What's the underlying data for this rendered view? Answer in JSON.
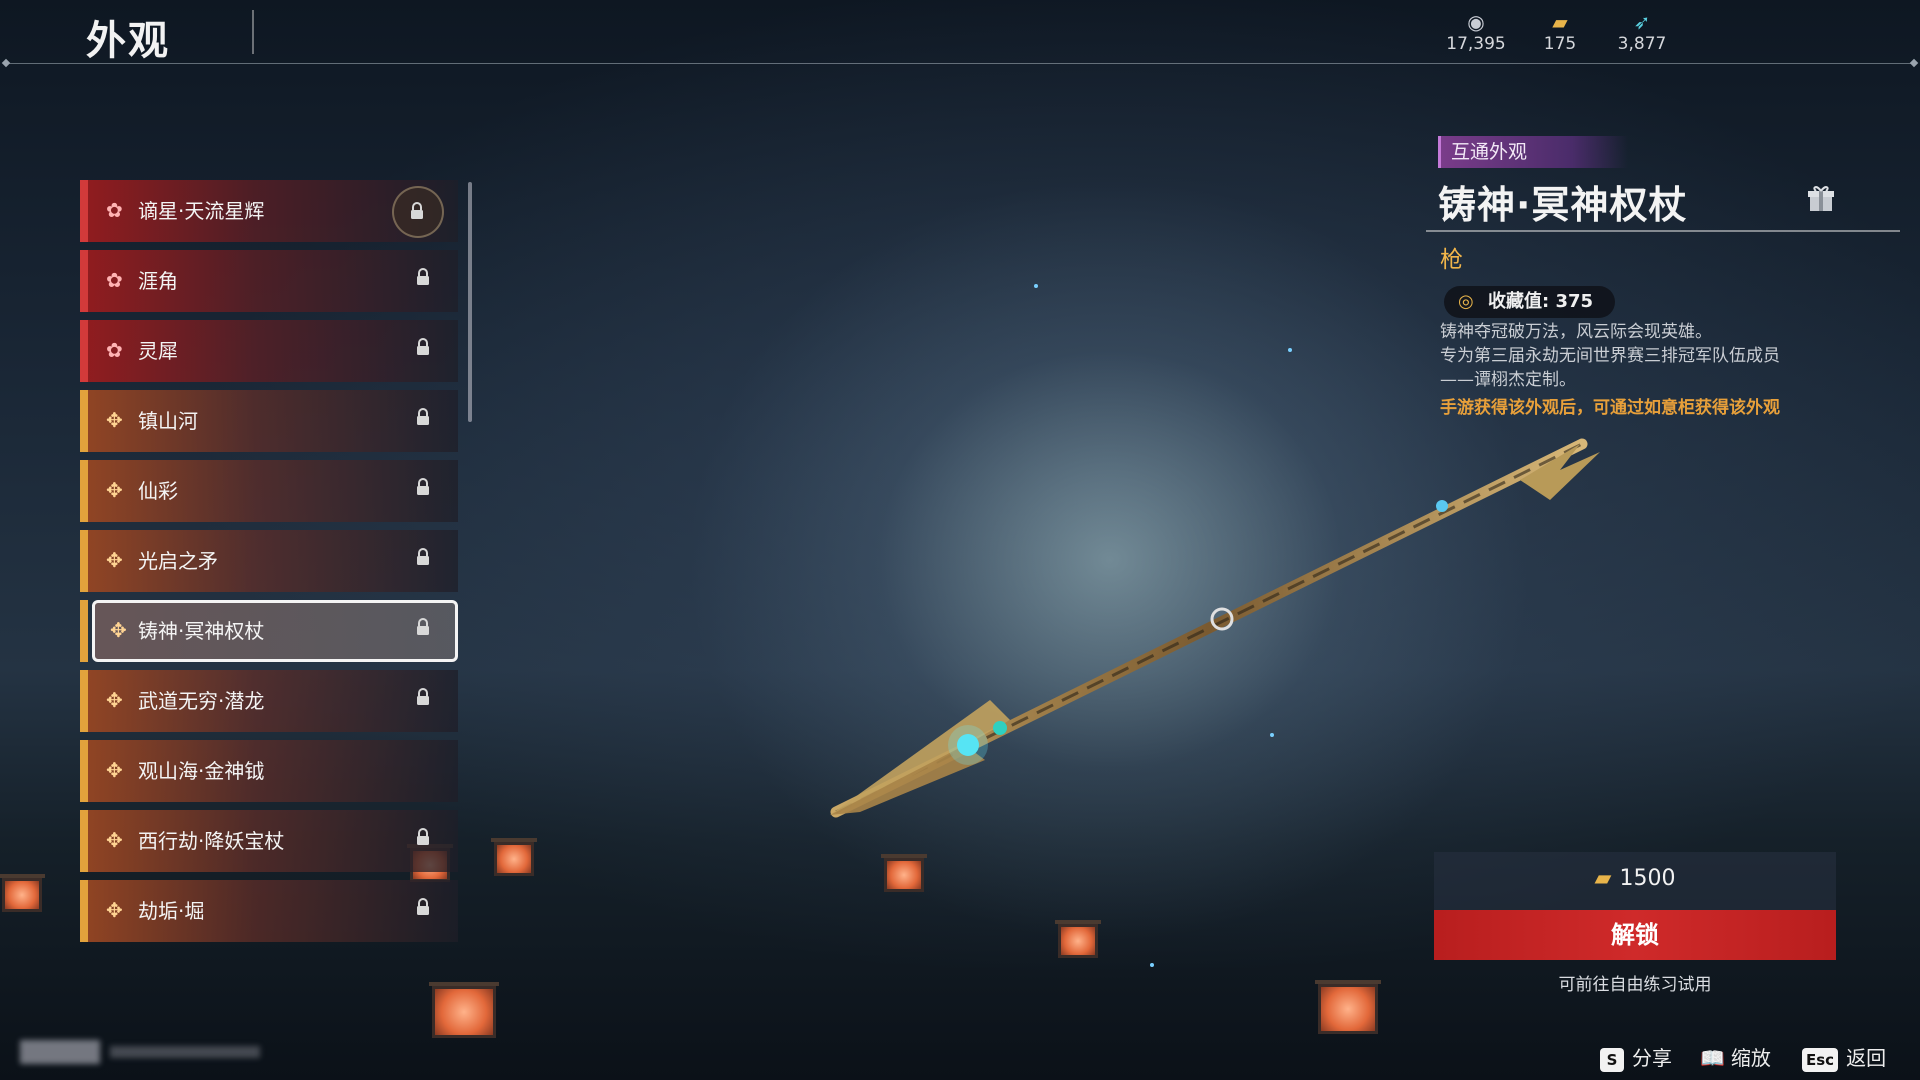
{
  "header": {
    "title": "外观",
    "currencies": [
      {
        "icon": "coin-icon",
        "value": "17,395"
      },
      {
        "icon": "gold-ingot-icon",
        "value": "175"
      },
      {
        "icon": "feather-icon",
        "value": "3,877"
      }
    ]
  },
  "list": {
    "items": [
      {
        "label": "谪星·天流星辉",
        "rarity": "red",
        "icon": "star-icon",
        "locked": true,
        "badge": true
      },
      {
        "label": "涯角",
        "rarity": "red",
        "icon": "star-icon",
        "locked": true
      },
      {
        "label": "灵犀",
        "rarity": "red",
        "icon": "star-icon",
        "locked": true
      },
      {
        "label": "镇山河",
        "rarity": "gold",
        "icon": "cross-icon",
        "locked": true
      },
      {
        "label": "仙彩",
        "rarity": "gold",
        "icon": "cross-icon",
        "locked": true
      },
      {
        "label": "光启之矛",
        "rarity": "gold",
        "icon": "cross-icon",
        "locked": true
      },
      {
        "label": "铸神·冥神权杖",
        "rarity": "gold",
        "icon": "cross-icon",
        "locked": true,
        "selected": true
      },
      {
        "label": "武道无穷·潜龙",
        "rarity": "gold",
        "icon": "cross-icon",
        "locked": true
      },
      {
        "label": "观山海·金神钺",
        "rarity": "gold",
        "icon": "cross-icon",
        "locked": false
      },
      {
        "label": "西行劫·降妖宝杖",
        "rarity": "gold",
        "icon": "cross-icon",
        "locked": true
      },
      {
        "label": "劫垢·堀",
        "rarity": "gold",
        "icon": "cross-icon",
        "locked": true
      }
    ]
  },
  "detail": {
    "tag": "互通外观",
    "name": "铸神·冥神权杖",
    "type": "枪",
    "collection_label": "收藏值: 375",
    "description_lines": [
      "铸神夺冠破万法，风云际会现英雄。",
      "专为第三届永劫无间世界赛三排冠军队伍成员",
      "——谭栩杰定制。"
    ],
    "hint": "手游获得该外观后，可通过如意柜获得该外观",
    "price": "1500",
    "unlock_label": "解锁",
    "trial_note": "可前往自由练习试用"
  },
  "footer": [
    {
      "key": "S",
      "label": "分享"
    },
    {
      "key": "📖",
      "label": "缩放"
    },
    {
      "key": "Esc",
      "label": "返回"
    }
  ],
  "colors": {
    "red_rarity": "#d23a3a",
    "gold_rarity": "#e2a23c",
    "unlock_button": "#c62424",
    "hint_text": "#e8a03a",
    "tag_purple": "#7a3c8a"
  }
}
